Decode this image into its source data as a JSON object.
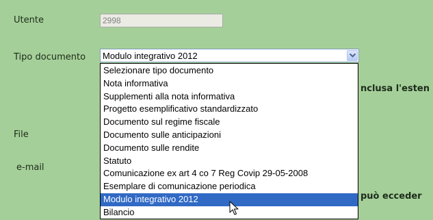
{
  "form": {
    "utente_label": "Utente",
    "utente_value": "2998",
    "tipo_label": "Tipo documento",
    "file_label": "File",
    "email_label": "e-mail",
    "background_color": "#a5cf98"
  },
  "tipo_select": {
    "selected_value": "Modulo integrativo 2012",
    "arrow_icon": "chevron-down-icon",
    "options": [
      "Selezionare tipo documento",
      "Nota informativa",
      "Supplementi alla nota informativa",
      "Progetto esemplificativo standardizzato",
      "Documento sul regime fiscale",
      "Documento sulle anticipazioni",
      "Documento sulle rendite",
      "Statuto",
      "Comunicazione ex art 4 co 7 Reg Covip 29-05-2008",
      "Esemplare di comunicazione periodica",
      "Modulo integrativo 2012",
      "Bilancio"
    ],
    "highlighted_index": 10,
    "highlight_color": "#316ac5"
  },
  "notes": {
    "estensione_fragment": "nclusa l'esten",
    "eccedere_fragment": "può ecceder"
  },
  "cursor": {
    "icon": "mouse-pointer-icon"
  }
}
